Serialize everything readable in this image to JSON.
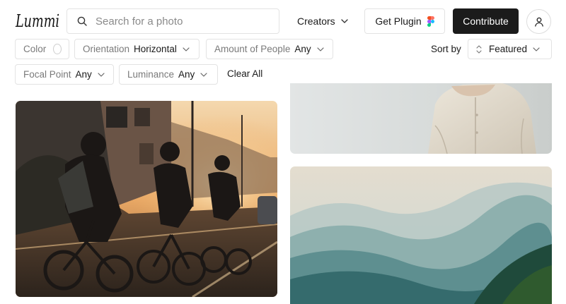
{
  "header": {
    "logo_text": "Lummi",
    "search": {
      "placeholder": "Search for a photo",
      "value": ""
    },
    "creators_label": "Creators",
    "plugin_label": "Get Plugin",
    "contribute_label": "Contribute"
  },
  "filters": {
    "color_label": "Color",
    "orientation": {
      "label": "Orientation",
      "value": "Horizontal"
    },
    "people": {
      "label": "Amount of People",
      "value": "Any"
    },
    "focal": {
      "label": "Focal Point",
      "value": "Any"
    },
    "luminance": {
      "label": "Luminance",
      "value": "Any"
    },
    "clear_all": "Clear All"
  },
  "sort": {
    "label": "Sort by",
    "value": "Featured"
  },
  "colors": {
    "accent": "#1b1b1b",
    "border": "#e3e3e3"
  },
  "icons": [
    "search-icon",
    "chevron-down-icon",
    "figma-icon",
    "user-icon",
    "sort-icon"
  ]
}
